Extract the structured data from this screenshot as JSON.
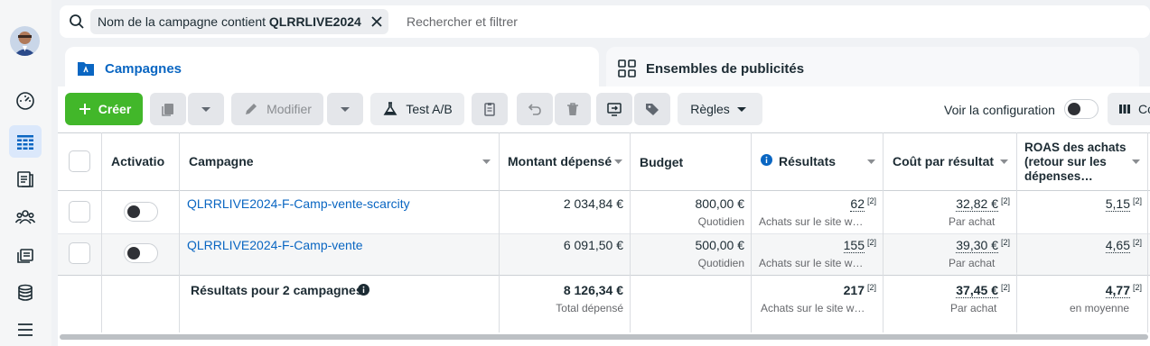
{
  "search": {
    "chip_prefix": "Nom de la campagne contient ",
    "chip_value": "QLRRLIVE2024",
    "placeholder": "Rechercher et filtrer"
  },
  "tabs": [
    {
      "label": "Campagnes",
      "active": true
    },
    {
      "label": "Ensembles de publicités",
      "active": false
    }
  ],
  "toolbar": {
    "create": "Créer",
    "edit": "Modifier",
    "ab_test": "Test A/B",
    "rules": "Règles",
    "view_config": "Voir la configuration",
    "columns": "Co"
  },
  "table": {
    "headers": {
      "activation": "Activatio",
      "campaign": "Campagne",
      "spent": "Montant dépensé",
      "budget": "Budget",
      "results": "Résultats",
      "cost": "Coût par résultat",
      "roas_line1": "ROAS des achats",
      "roas_line2": "(retour sur les",
      "roas_line3": "dépenses…"
    },
    "rows": [
      {
        "name": "QLRRLIVE2024-F-Camp-vente-scarcity",
        "spent": "2 034,84 €",
        "budget": "800,00 €",
        "budget_sub": "Quotidien",
        "results": "62",
        "results_sup": "[2]",
        "results_sub": "Achats sur le site w…",
        "cost": "32,82 €",
        "cost_sup": "[2]",
        "cost_sub": "Par achat",
        "roas": "5,15",
        "roas_sup": "[2]"
      },
      {
        "name": "QLRRLIVE2024-F-Camp-vente",
        "spent": "6 091,50 €",
        "budget": "500,00 €",
        "budget_sub": "Quotidien",
        "results": "155",
        "results_sup": "[2]",
        "results_sub": "Achats sur le site w…",
        "cost": "39,30 €",
        "cost_sup": "[2]",
        "cost_sub": "Par achat",
        "roas": "4,65",
        "roas_sup": "[2]"
      }
    ],
    "totals": {
      "label": "Résultats pour 2 campagnes",
      "spent": "8 126,34 €",
      "spent_sub": "Total dépensé",
      "results": "217",
      "results_sup": "[2]",
      "results_sub": "Achats sur le site w…",
      "cost": "37,45 €",
      "cost_sup": "[2]",
      "cost_sub": "Par achat",
      "roas": "4,77",
      "roas_sup": "[2]",
      "roas_sub": "en moyenne"
    }
  },
  "colors": {
    "accent": "#0a66c2",
    "create_button": "#42b72a",
    "active_nav": "#dbe8fb"
  }
}
